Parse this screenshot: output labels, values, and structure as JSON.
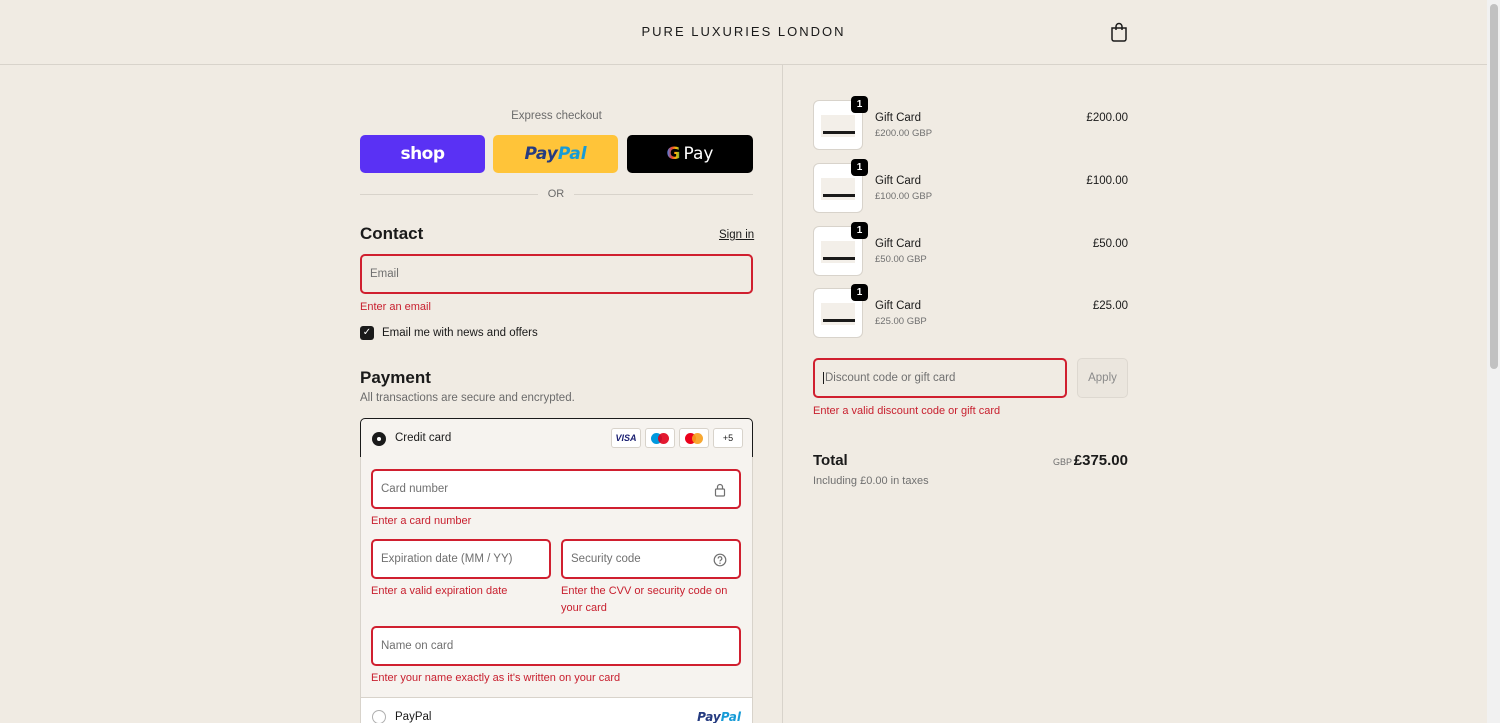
{
  "header": {
    "brand": "PURE LUXURIES LONDON"
  },
  "express": {
    "title": "Express checkout",
    "shop_label": "shop",
    "paypal_label_1": "Pay",
    "paypal_label_2": "Pal",
    "gpay_label_g": "G",
    "gpay_label": "Pay",
    "or": "OR"
  },
  "contact": {
    "title": "Contact",
    "sign_in": "Sign in",
    "email_placeholder": "Email",
    "email_error": "Enter an email",
    "newsletter_label": "Email me with news and offers",
    "newsletter_checked": true
  },
  "payment": {
    "title": "Payment",
    "subtitle": "All transactions are secure and encrypted.",
    "credit_card_label": "Credit card",
    "card_logos": [
      "VISA",
      "Maestro",
      "Mastercard",
      "+5"
    ],
    "card_number_placeholder": "Card number",
    "card_number_error": "Enter a card number",
    "expiry_placeholder": "Expiration date (MM / YY)",
    "expiry_error": "Enter a valid expiration date",
    "cvv_placeholder": "Security code",
    "cvv_error_1": "Enter the CVV or security code on",
    "cvv_error_2": "your card",
    "name_placeholder": "Name on card",
    "name_error": "Enter your name exactly as it's written on your card",
    "paypal_label": "PayPal",
    "paypal_logo_1": "Pay",
    "paypal_logo_2": "Pal"
  },
  "summary": {
    "items": [
      {
        "name": "Gift Card",
        "sub": "£200.00 GBP",
        "price": "£200.00",
        "qty": "1"
      },
      {
        "name": "Gift Card",
        "sub": "£100.00 GBP",
        "price": "£100.00",
        "qty": "1"
      },
      {
        "name": "Gift Card",
        "sub": "£50.00 GBP",
        "price": "£50.00",
        "qty": "1"
      },
      {
        "name": "Gift Card",
        "sub": "£25.00 GBP",
        "price": "£25.00",
        "qty": "1"
      }
    ],
    "discount_placeholder": "Discount code or gift card",
    "discount_error": "Enter a valid discount code or gift card",
    "apply": "Apply",
    "total_label": "Total",
    "currency": "GBP",
    "total": "£375.00",
    "taxes": "Including £0.00 in taxes"
  },
  "colors": {
    "error": "#c8202f",
    "shop": "#5a31f4",
    "paypal": "#ffc439",
    "background": "#f0ebe3"
  }
}
